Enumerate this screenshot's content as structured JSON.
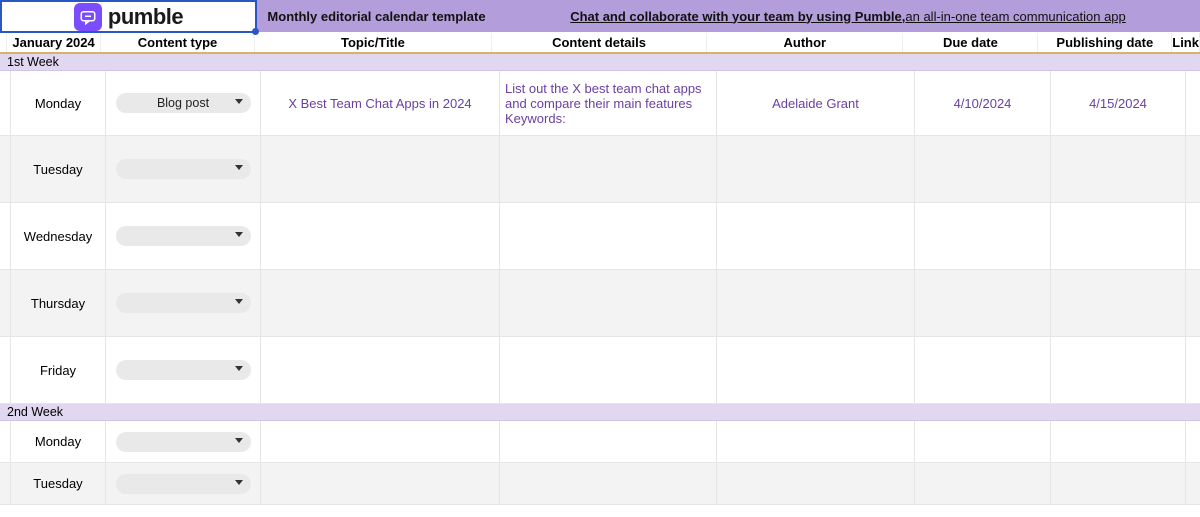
{
  "brand": {
    "name": "pumble"
  },
  "topbar": {
    "title": "Monthly editorial calendar template",
    "promo_bold": "Chat and collaborate with your team by using Pumble,",
    "promo_rest": " an all-in-one team communication app"
  },
  "columns": {
    "month": "January 2024",
    "type": "Content type",
    "topic": "Topic/Title",
    "details": "Content details",
    "author": "Author",
    "due": "Due date",
    "pub": "Publishing date",
    "link": "Link"
  },
  "weeks": {
    "w1": "1st Week",
    "w2": "2nd Week"
  },
  "days": {
    "mon": "Monday",
    "tue": "Tuesday",
    "wed": "Wednesday",
    "thu": "Thursday",
    "fri": "Friday"
  },
  "row1": {
    "content_type": "Blog post",
    "topic": "X Best Team Chat Apps in 2024",
    "details": "List out the X best team chat apps and compare their main features Keywords:",
    "author": "Adelaide Grant",
    "due": "4/10/2024",
    "pub": "4/15/2024"
  }
}
